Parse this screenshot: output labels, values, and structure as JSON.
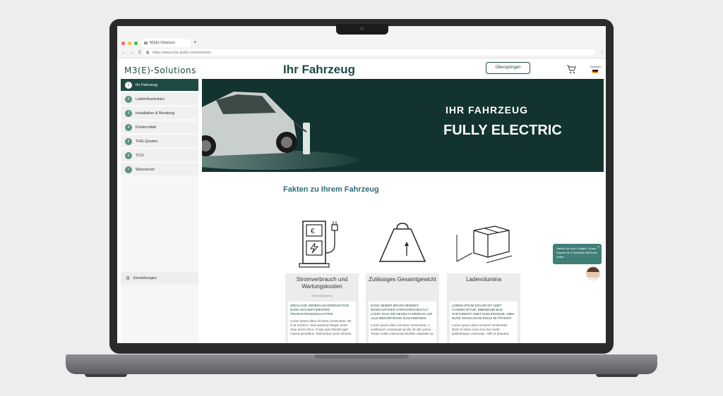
{
  "browser": {
    "tab_title": "M3(E)-Solutions",
    "new_tab": "+",
    "url": "https://www.m3e-gmbh.com/solutions",
    "nav": [
      "←",
      "→",
      "C"
    ]
  },
  "header": {
    "logo": "M3(E)-Solutions",
    "title": "Ihr Fahrzeug",
    "skip_button": "Überspringen",
    "language": "Deutsch"
  },
  "sidebar": {
    "items": [
      {
        "num": "1",
        "label": "Ihr Fahrzeug",
        "active": true
      },
      {
        "num": "2",
        "label": "Ladeinfrastruktur"
      },
      {
        "num": "3",
        "label": "Installation & Beratung"
      },
      {
        "num": "4",
        "label": "Fördermittel"
      },
      {
        "num": "5",
        "label": "THG-Quoten"
      },
      {
        "num": "6",
        "label": "TCO"
      },
      {
        "num": "7",
        "label": "Warenkorb"
      }
    ],
    "settings": "Einstellungen"
  },
  "hero": {
    "line1": "IHR FAHRZEUG",
    "line2": "FULLY ELECTRIC"
  },
  "facts_heading": "Fakten zu Ihrem Fahrzeug",
  "cards": [
    {
      "title": "Stromverbrauch und Wartungskosten",
      "subtitle": "Effizienzsteigerung",
      "heading": "MÖGLICHE VERBRAUCHSREDUKTION DANK HOCHEFFIZIENTER PRODUKTEIGENSCHAFTEN",
      "text": "Lorem ipsum dolor sit amet consectetur. Sit in at morbi in. Sed euismod integer amet vitae amet netus. Turpis quis blandit eget massa penatibus. Elementum proin lobortis."
    },
    {
      "title": "Zulässiges Gesamtgewicht",
      "subtitle": "",
      "heading": "DANK SEINER BRANCHENWEIT EINZIGARTIGEN VARIANTENVIELFALT LÄSST SICH IHR NEUES FAHRZEUG AUF ALLE BEDÜRFNISSE ZUSCHNEIDEN.",
      "text": "Lorem ipsum dolor sit amet consectetur. A vestibulum consequat iaculis sit odio purus. Turpis mattis maecenas facilisis vulputate at."
    },
    {
      "title": "Ladevolumina",
      "subtitle": "",
      "heading": "LOREM IPSUM DOLOR SIT AMET CONSECTETUR. BIBENDUM MUS PARTURIENT AMET SCELERISQUE. NIBH NUNC MASSA DIAM RISUS MI POTENTI.",
      "text": "Lorem ipsum dolor sit amet consectetur. Diam in netus urna eros dui morbi pellentesque commodo. Velit ut pharetra."
    }
  ],
  "chat": {
    "message": "Haben Sie noch Fragen? Unser Experte für E-Mobilität hilft Ihnen weiter.",
    "close": "×"
  },
  "colors": {
    "brand": "#1e4a43",
    "accent": "#2e6c77",
    "chat": "#3f7f78"
  },
  "icons": [
    "cart-icon",
    "germany-flag-icon",
    "gear-icon",
    "charging-station-icon",
    "weight-icon",
    "box-icon"
  ]
}
